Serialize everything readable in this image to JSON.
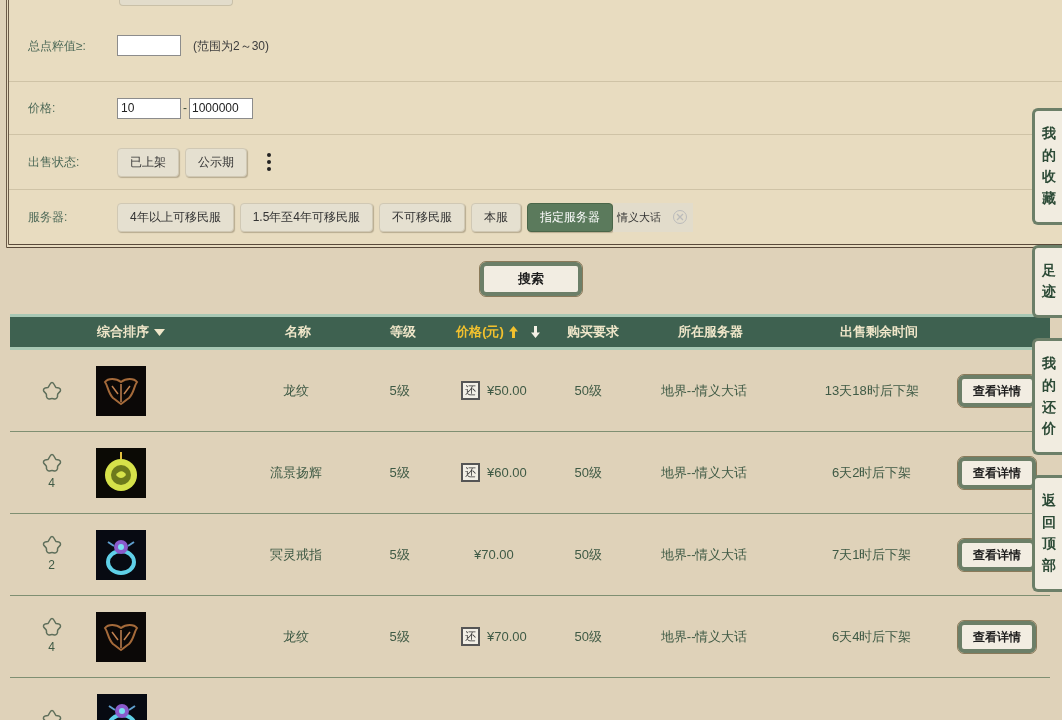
{
  "filters": {
    "points": {
      "label": "总点粹值≥:",
      "hint": "(范围为2～30)"
    },
    "price": {
      "label": "价格:",
      "min": "10",
      "separator": "-",
      "max": "1000000"
    },
    "status": {
      "label": "出售状态:",
      "options": [
        {
          "label": "已上架",
          "selected": false
        },
        {
          "label": "公示期",
          "selected": false
        }
      ]
    },
    "server": {
      "label": "服务器:",
      "options": [
        {
          "label": "4年以上可移民服",
          "selected": false
        },
        {
          "label": "1.5年至4年可移民服",
          "selected": false
        },
        {
          "label": "不可移民服",
          "selected": false
        },
        {
          "label": "本服",
          "selected": false
        },
        {
          "label": "指定服务器",
          "selected": true
        }
      ],
      "tag": "情义大话"
    }
  },
  "search_button": "搜索",
  "table": {
    "columns": [
      {
        "label": "综合排序",
        "kind": "sort",
        "selected": false
      },
      {
        "label": "名称",
        "kind": "plain"
      },
      {
        "label": "等级",
        "kind": "plain"
      },
      {
        "label": "价格(元)",
        "kind": "price_sort",
        "selected": true
      },
      {
        "label": "购买要求",
        "kind": "plain"
      },
      {
        "label": "所在服务器",
        "kind": "plain"
      },
      {
        "label": "出售剩余时间",
        "kind": "plain"
      }
    ],
    "rows": [
      {
        "kind": "wing",
        "name": "龙纹",
        "level": "5级",
        "bargain": "还",
        "price": "¥50.00",
        "requirement": "50级",
        "server": "地界--情义大话",
        "time": "13天18时后下架",
        "action": "查看详情"
      },
      {
        "favorites": "4",
        "kind": "medallion",
        "name": "流景扬辉",
        "level": "5级",
        "bargain": "还",
        "price": "¥60.00",
        "requirement": "50级",
        "server": "地界--情义大话",
        "time": "6天2时后下架",
        "action": "查看详情"
      },
      {
        "favorites": "2",
        "kind": "ring",
        "name": "冥灵戒指",
        "level": "5级",
        "price": "¥70.00",
        "requirement": "50级",
        "server": "地界--情义大话",
        "time": "7天1时后下架",
        "action": "查看详情"
      },
      {
        "favorites": "4",
        "kind": "wing",
        "name": "龙纹",
        "level": "5级",
        "bargain": "还",
        "price": "¥70.00",
        "requirement": "50级",
        "server": "地界--情义大话",
        "time": "6天4时后下架",
        "action": "查看详情"
      },
      {
        "kind": "ring"
      }
    ]
  },
  "side_tabs": [
    "我的收藏",
    "足迹",
    "我的还价",
    "返回顶部"
  ]
}
